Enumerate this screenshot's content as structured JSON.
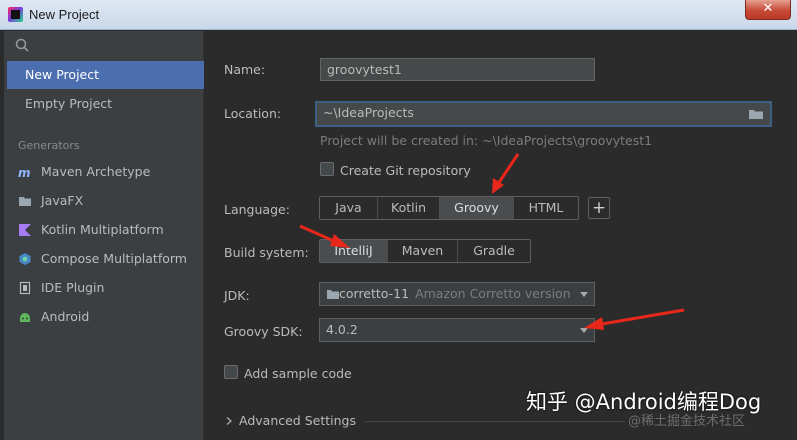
{
  "window": {
    "title": "New Project",
    "close_glyph": "✕"
  },
  "sidebar": {
    "items": [
      {
        "label": "New Project"
      },
      {
        "label": "Empty Project"
      }
    ],
    "section_label": "Generators",
    "generators": [
      {
        "label": "Maven Archetype",
        "icon": "maven-icon"
      },
      {
        "label": "JavaFX",
        "icon": "folder-icon"
      },
      {
        "label": "Kotlin Multiplatform",
        "icon": "kotlin-icon"
      },
      {
        "label": "Compose Multiplatform",
        "icon": "compose-icon"
      },
      {
        "label": "IDE Plugin",
        "icon": "plugin-icon"
      },
      {
        "label": "Android",
        "icon": "android-icon"
      }
    ]
  },
  "form": {
    "name_label": "Name:",
    "name_value": "groovytest1",
    "location_label": "Location:",
    "location_value": "~\\IdeaProjects",
    "location_hint": "Project will be created in: ~\\IdeaProjects\\groovytest1",
    "git_label": "Create Git repository",
    "language_label": "Language:",
    "languages": [
      "Java",
      "Kotlin",
      "Groovy",
      "HTML"
    ],
    "language_selected": "Groovy",
    "plus_label": "+",
    "build_label": "Build system:",
    "build_systems": [
      "IntelliJ",
      "Maven",
      "Gradle"
    ],
    "build_selected": "IntelliJ",
    "jdk_label": "JDK:",
    "jdk_value": "corretto-11",
    "jdk_detail": "Amazon Corretto version",
    "groovy_sdk_label": "Groovy SDK:",
    "groovy_sdk_value": "4.0.2",
    "sample_code_label": "Add sample code",
    "advanced_label": "Advanced Settings"
  },
  "watermark": {
    "main": "知乎 @Android编程Dog",
    "sub": "@稀土掘金技术社区"
  },
  "colors": {
    "accent": "#4b6eaf",
    "annotation": "#e8271b"
  }
}
